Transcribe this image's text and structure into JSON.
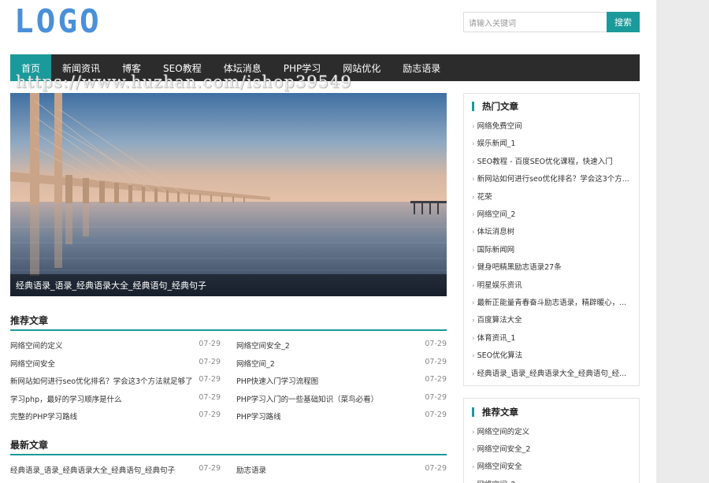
{
  "header": {
    "logo_text": "LOGO",
    "search_placeholder": "请输入关键词",
    "search_button": "搜索"
  },
  "nav": {
    "items": [
      "首页",
      "新闻资讯",
      "博客",
      "SEO教程",
      "体坛消息",
      "PHP学习",
      "网站优化",
      "励志语录"
    ],
    "active_index": 0
  },
  "watermark": "https://www.huzhan.com/ishop39549",
  "hero": {
    "caption": "经典语录_语录_经典语录大全_经典语句_经典句子"
  },
  "recommended": {
    "title": "推荐文章",
    "left": [
      {
        "title": "网络空间的定义",
        "date": "07-29"
      },
      {
        "title": "网络空间安全",
        "date": "07-29"
      },
      {
        "title": "新网站如何进行seo优化排名？学会这3个方法就足够了",
        "date": "07-29"
      },
      {
        "title": "学习php，最好的学习顺序是什么",
        "date": "07-29"
      },
      {
        "title": "完整的PHP学习路线",
        "date": "07-29"
      }
    ],
    "right": [
      {
        "title": "网络空间安全_2",
        "date": "07-29"
      },
      {
        "title": "网络空间_2",
        "date": "07-29"
      },
      {
        "title": "PHP快速入门学习流程图",
        "date": "07-29"
      },
      {
        "title": "PHP学习入门的一些基础知识（菜鸟必看）",
        "date": "07-29"
      },
      {
        "title": "PHP学习路线",
        "date": "07-29"
      }
    ]
  },
  "latest": {
    "title": "最新文章",
    "left": [
      {
        "title": "经典语录_语录_经典语录大全_经典语句_经典句子",
        "date": "07-29"
      }
    ],
    "right": [
      {
        "title": "励志语录",
        "date": "07-29"
      }
    ]
  },
  "hot": {
    "title": "热门文章",
    "items": [
      "网络免费空间",
      "娱乐新闻_1",
      "SEO教程 - 百度SEO优化课程，快速入门",
      "新网站如何进行seo优化排名？学会这3个方...",
      "花荣",
      "网络空间_2",
      "体坛消息树",
      "国际新闻网",
      "健身吧精黑励志语录27条",
      "明星娱乐资讯",
      "最新正能量青春奋斗励志语录，精辟暖心，...",
      "百度算法大全",
      "体育资讯_1",
      "SEO优化算法",
      "经典语录_语录_经典语录大全_经典语句_经..."
    ]
  },
  "side_recommended": {
    "title": "推荐文章",
    "items": [
      "网络空间的定义",
      "网络空间安全_2",
      "网络空间安全",
      "网络空间_2"
    ]
  },
  "colors": {
    "accent": "#1a9a9a",
    "nav_bg": "#2c2c2c",
    "logo": "#4a90d9"
  }
}
